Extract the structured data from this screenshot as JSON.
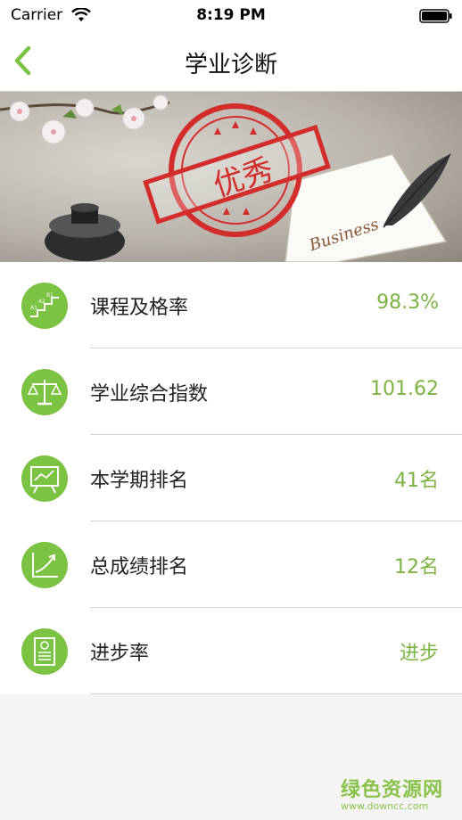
{
  "status_bar": {
    "carrier": "Carrier",
    "time": "8:19 PM"
  },
  "nav": {
    "title": "学业诊断",
    "back_icon": "chevron-left-icon",
    "accent": "#7cc243"
  },
  "banner": {
    "stamp_text": "优秀",
    "paper_text": "Business"
  },
  "items": [
    {
      "label": "课程及格率",
      "value": "98.3%",
      "icon": "stairs-icon"
    },
    {
      "label": "学业综合指数",
      "value": "101.62",
      "icon": "scale-icon"
    },
    {
      "label": "本学期排名",
      "value": "41名",
      "icon": "presentation-board-icon"
    },
    {
      "label": "总成绩排名",
      "value": "12名",
      "icon": "growth-chart-icon"
    },
    {
      "label": "进步率",
      "value": "进步",
      "icon": "report-card-icon"
    }
  ],
  "watermark": {
    "title": "绿色资源网",
    "url": "www.downcc.com"
  }
}
